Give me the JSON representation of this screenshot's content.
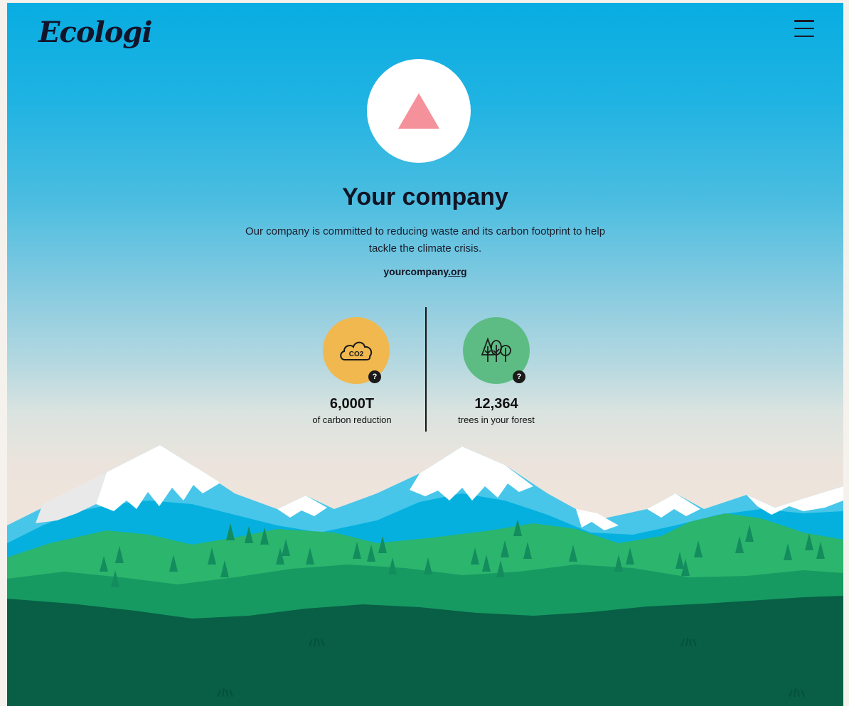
{
  "brand": {
    "logo_text": "Ecologi"
  },
  "header": {
    "menu_icon": "hamburger-menu-icon"
  },
  "profile": {
    "avatar_icon": "triangle-logo-icon",
    "avatar_color": "#f4919b",
    "company_name": "Your company",
    "description": "Our company is committed to reducing waste and its carbon footprint to help tackle the climate crisis.",
    "website_name": "yourcompany",
    "website_tld": ".org"
  },
  "stats": [
    {
      "icon": "co2-cloud-icon",
      "color": "#f0b84e",
      "value": "6,000T",
      "label": "of carbon reduction",
      "help": "?"
    },
    {
      "icon": "trees-icon",
      "color": "#5dbc83",
      "value": "12,364",
      "label": "trees in your forest",
      "help": "?"
    }
  ]
}
